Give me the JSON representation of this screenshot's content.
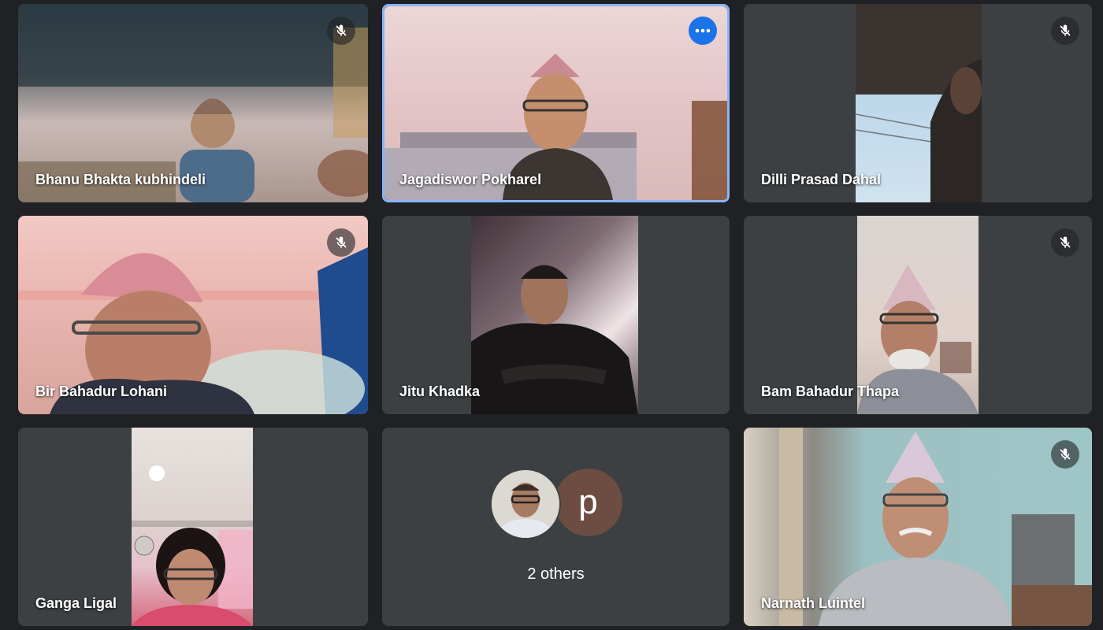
{
  "participants": [
    {
      "name": "Bhanu Bhakta kubhindeli",
      "muted": true
    },
    {
      "name": "Jagadiswor Pokharel",
      "muted": false,
      "active_speaker": true
    },
    {
      "name": "Dilli Prasad Dahal",
      "muted": true
    },
    {
      "name": "Bir Bahadur Lohani",
      "muted": true
    },
    {
      "name": "Jitu Khadka",
      "muted": false
    },
    {
      "name": "Bam Bahadur Thapa",
      "muted": true
    },
    {
      "name": "Ganga Ligal",
      "muted": false
    },
    {
      "name": "Narnath Luintel",
      "muted": true
    }
  ],
  "others_tile": {
    "label": "2 others",
    "avatar_letter": "p",
    "avatar_color": "#6d4c41"
  },
  "colors": {
    "background": "#202124",
    "tile": "#3c4043",
    "accent": "#1a73e8",
    "active_border": "#8ab4f8"
  },
  "icons": {
    "mute": "mic-off-icon",
    "more": "more-options-icon"
  }
}
